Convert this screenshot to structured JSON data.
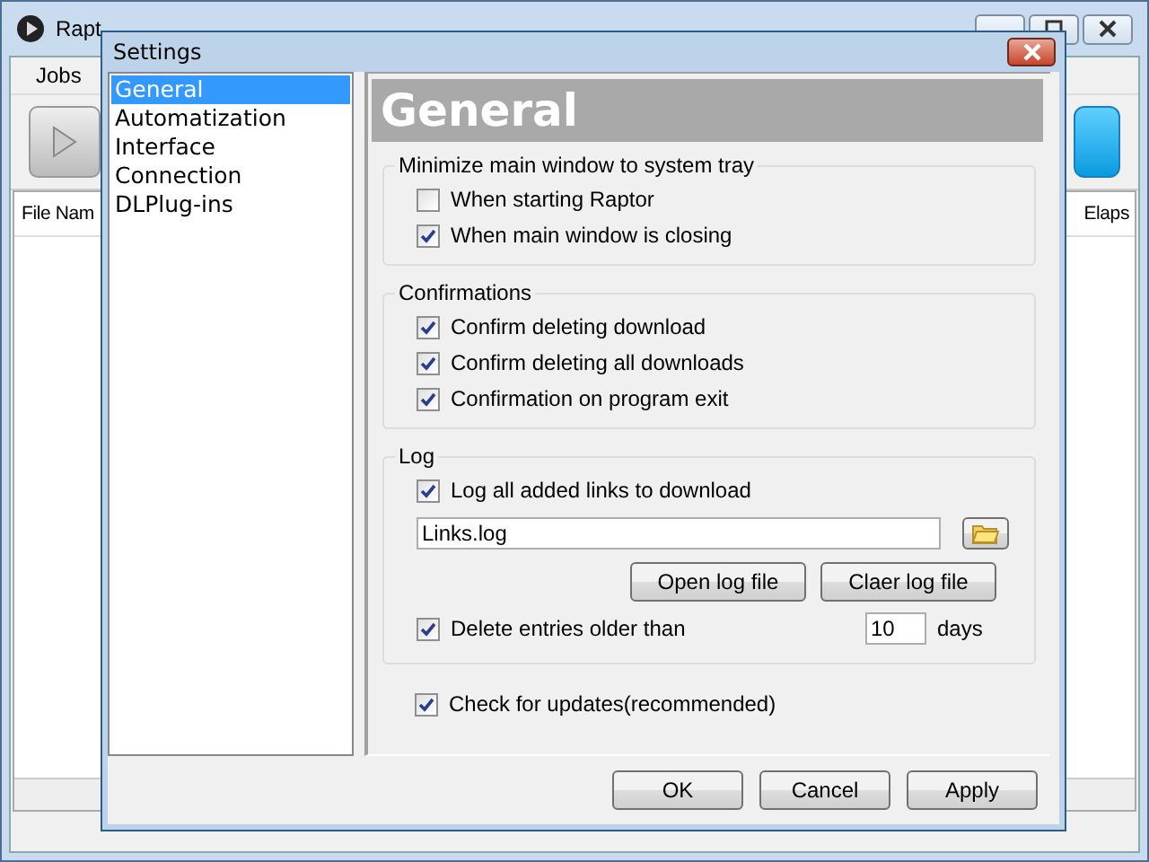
{
  "main_window": {
    "title": "Rapt",
    "menu": [
      "Jobs"
    ],
    "columns": [
      "File Nam",
      "Elaps"
    ]
  },
  "dialog": {
    "title": "Settings",
    "categories": [
      {
        "label": "General",
        "selected": true
      },
      {
        "label": "Automatization",
        "selected": false
      },
      {
        "label": "Interface",
        "selected": false
      },
      {
        "label": "Connection",
        "selected": false
      },
      {
        "label": "DLPlug-ins",
        "selected": false
      }
    ],
    "panel_title": "General",
    "groups": [
      {
        "title": "Minimize main window to system tray",
        "items": [
          {
            "kind": "checkbox",
            "label": "When starting Raptor",
            "checked": false
          },
          {
            "kind": "checkbox",
            "label": "When main window is closing",
            "checked": true
          }
        ]
      },
      {
        "title": "Confirmations",
        "items": [
          {
            "kind": "checkbox",
            "label": "Confirm deleting download",
            "checked": true
          },
          {
            "kind": "checkbox",
            "label": "Confirm deleting all downloads",
            "checked": true
          },
          {
            "kind": "checkbox",
            "label": "Confirmation on program exit",
            "checked": true
          }
        ]
      },
      {
        "title": "Log",
        "items": [
          {
            "kind": "checkbox",
            "label": "Log all added links to download",
            "checked": true
          },
          {
            "kind": "file",
            "value": "Links.log"
          },
          {
            "kind": "buttons",
            "buttons": [
              "Open log file",
              "Claer log file"
            ]
          },
          {
            "kind": "number",
            "label": "Delete entries older than",
            "checked": true,
            "value": "10",
            "unit": "days"
          }
        ]
      }
    ],
    "update_check": {
      "label": "Check for updates(recommended)",
      "checked": true
    },
    "buttons": [
      "OK",
      "Cancel",
      "Apply"
    ]
  }
}
